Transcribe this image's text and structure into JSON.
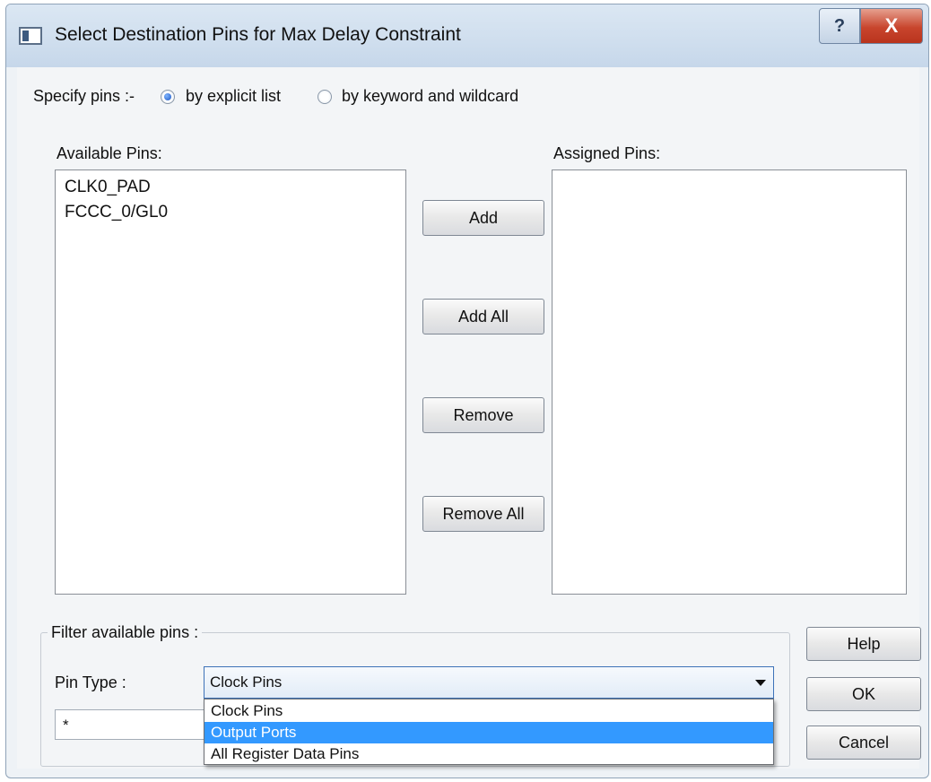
{
  "window": {
    "title": "Select Destination Pins for Max Delay Constraint",
    "help_glyph": "?",
    "close_glyph": "X"
  },
  "specify": {
    "label": "Specify pins :-",
    "options": [
      {
        "label": "by explicit list",
        "checked": true
      },
      {
        "label": "by keyword and wildcard",
        "checked": false
      }
    ]
  },
  "available": {
    "label": "Available Pins:",
    "items": [
      "CLK0_PAD",
      "FCCC_0/GL0"
    ]
  },
  "assigned": {
    "label": "Assigned Pins:",
    "items": []
  },
  "actions": {
    "add": "Add",
    "add_all": "Add All",
    "remove": "Remove",
    "remove_all": "Remove All"
  },
  "filter": {
    "title": "Filter available pins :",
    "pin_type_label": "Pin Type :",
    "pin_type_value": "Clock Pins",
    "pattern_value": "*",
    "dropdown_options": [
      "Clock Pins",
      "Output Ports",
      "All Register Data Pins"
    ],
    "highlighted_option": "Output Ports"
  },
  "buttons": {
    "help": "Help",
    "ok": "OK",
    "cancel": "Cancel"
  },
  "colors": {
    "selection": "#3399ff",
    "close_button": "#c8452d"
  }
}
